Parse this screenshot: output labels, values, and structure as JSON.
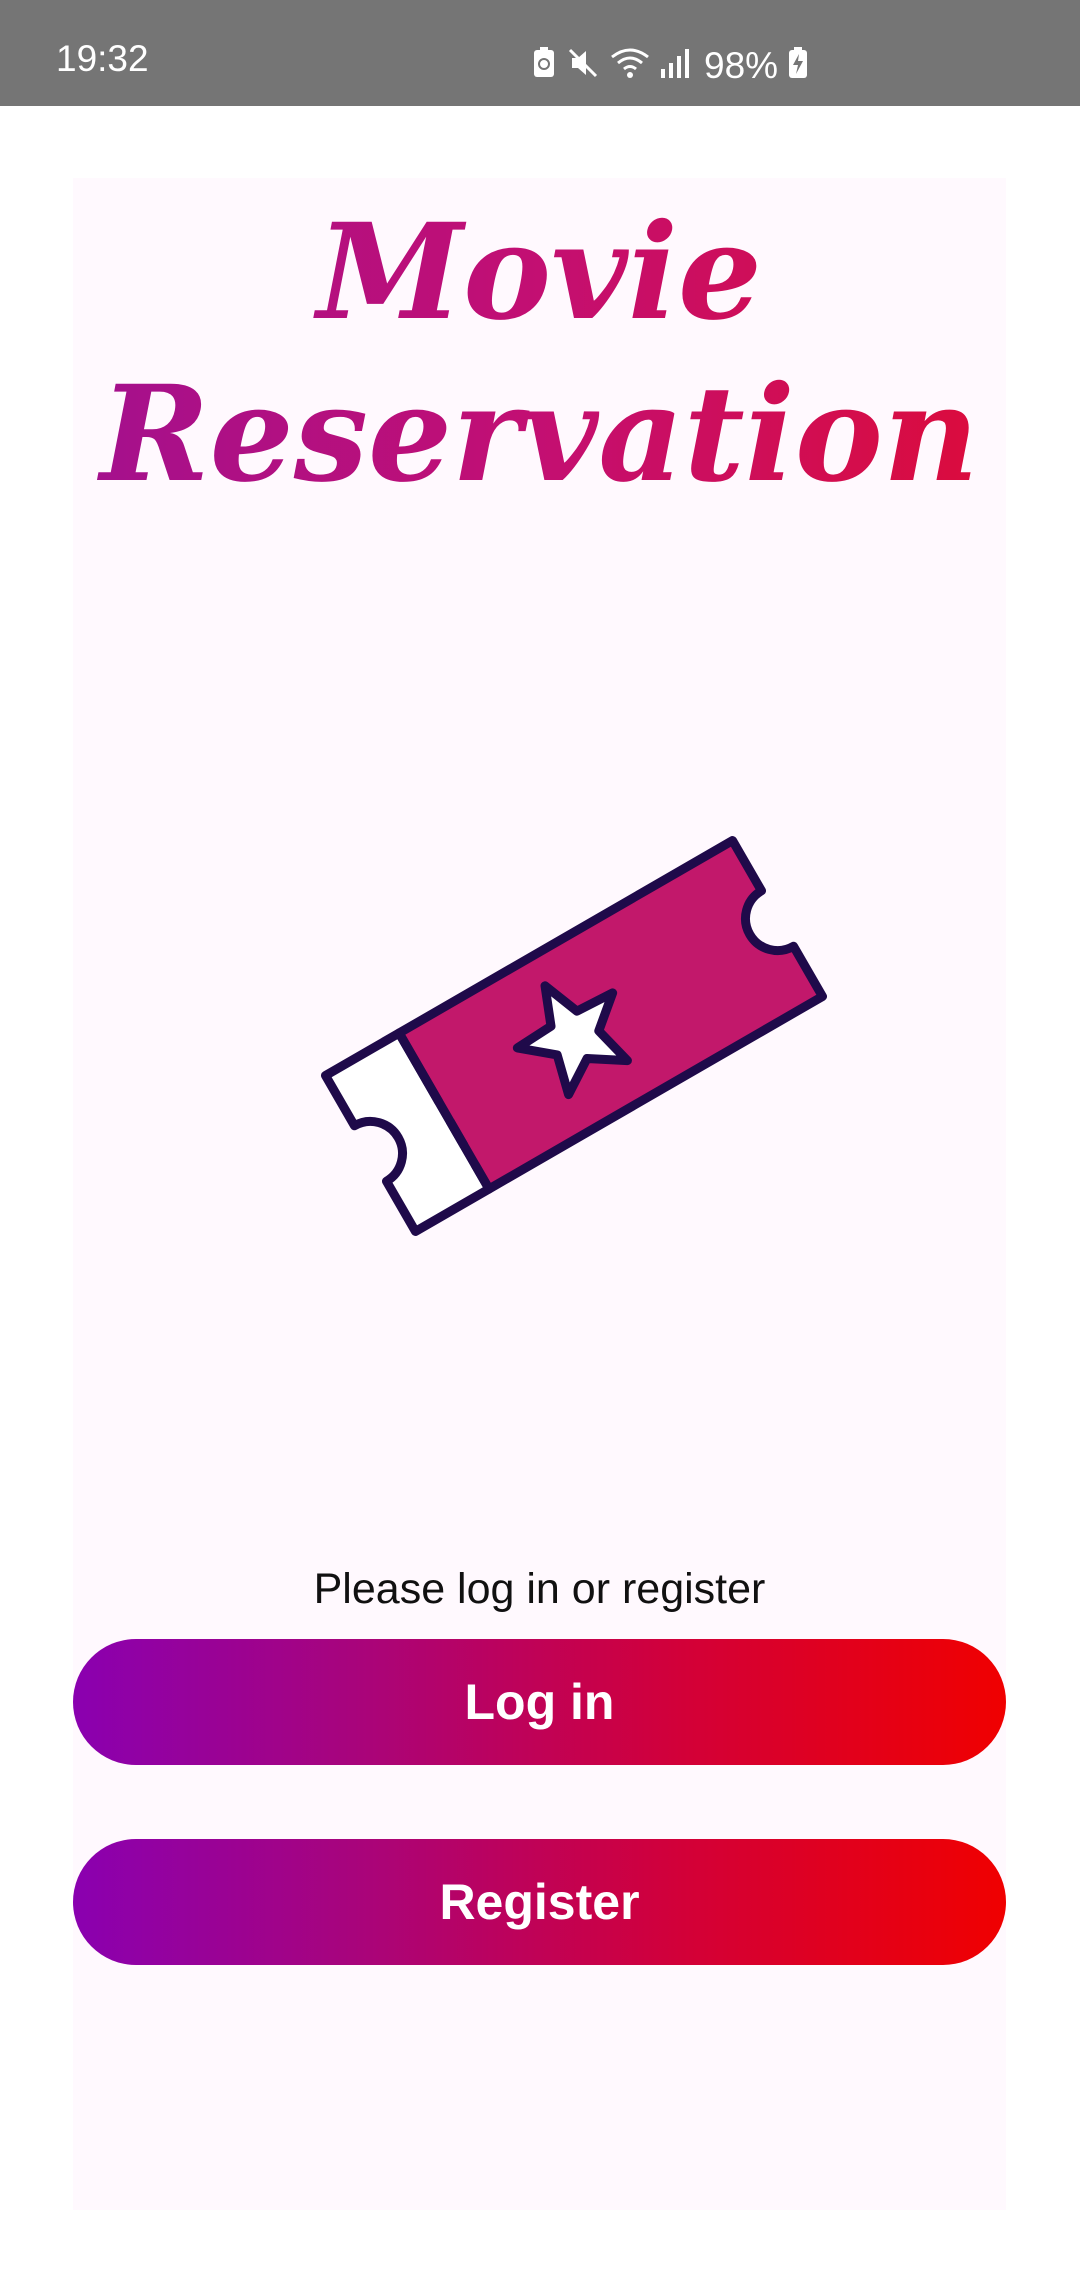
{
  "status_bar": {
    "time": "19:32",
    "battery_percent": "98%",
    "icons": [
      "screenshot-icon",
      "mute-icon",
      "wifi-icon",
      "signal-icon",
      "battery-charging-icon"
    ]
  },
  "app": {
    "title_line1": "Movie",
    "title_line2": "Reservation",
    "illustration": "ticket-star-icon",
    "prompt": "Please log in or register",
    "login_label": "Log in",
    "register_label": "Register"
  },
  "colors": {
    "status_bar_bg": "#757575",
    "card_bg": "#fff9fe",
    "ticket_fill": "#c2186b",
    "ticket_outline": "#1f0a4a",
    "gradient_start": "#8a00b0",
    "gradient_end": "#f00000"
  }
}
